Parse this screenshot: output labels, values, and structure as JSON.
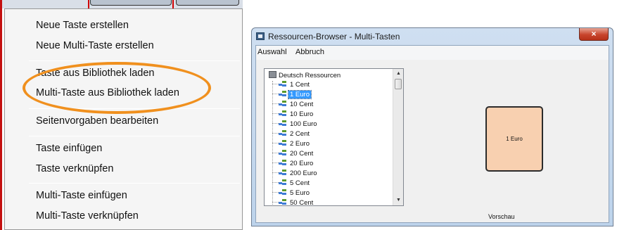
{
  "context_menu": {
    "items": [
      {
        "label": "Neue Taste erstellen"
      },
      {
        "label": "Neue Multi-Taste erstellen"
      },
      {
        "label": "Taste aus Bibliothek laden"
      },
      {
        "label": "Multi-Taste aus Bibliothek laden"
      },
      {
        "label": "Seitenvorgaben bearbeiten"
      },
      {
        "label": "Taste einfügen"
      },
      {
        "label": "Taste verknüpfen"
      },
      {
        "label": "Multi-Taste einfügen"
      },
      {
        "label": "Multi-Taste verknüpfen"
      }
    ],
    "highlight_color": "#f0901e"
  },
  "dialog": {
    "title": "Ressourcen-Browser - Multi-Tasten",
    "close_icon": "×",
    "menubar": [
      "Auswahl",
      "Abbruch"
    ],
    "tree": {
      "root": "Deutsch Ressourcen",
      "items": [
        "1 Cent",
        "1 Euro",
        "10 Cent",
        "10 Euro",
        "100 Euro",
        "2 Cent",
        "2 Euro",
        "20 Cent",
        "20 Euro",
        "200 Euro",
        "5 Cent",
        "5 Euro",
        "50 Cent"
      ],
      "selected": "1 Euro"
    },
    "preview": {
      "tile_text": "1 Euro",
      "tile_color": "#f8d0b0",
      "label": "Vorschau"
    }
  }
}
